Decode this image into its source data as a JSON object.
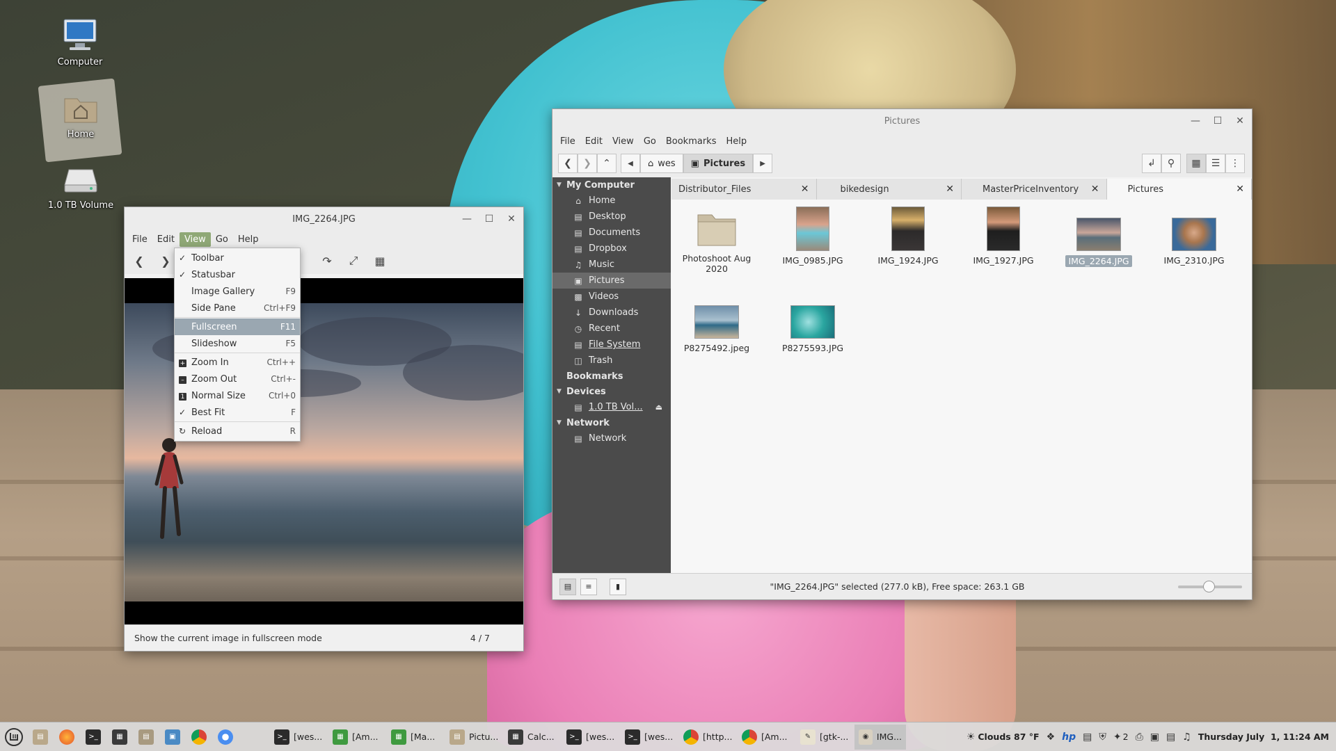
{
  "desktop": {
    "icons": [
      {
        "label": "Computer"
      },
      {
        "label": "Home"
      },
      {
        "label": "1.0 TB Volume"
      }
    ]
  },
  "viewer": {
    "title": "IMG_2264.JPG",
    "menu": [
      "File",
      "Edit",
      "View",
      "Go",
      "Help"
    ],
    "view_menu": [
      {
        "label": "Toolbar",
        "accel": "",
        "mark": "check"
      },
      {
        "label": "Statusbar",
        "accel": "",
        "mark": "check"
      },
      {
        "label": "Image Gallery",
        "accel": "F9",
        "mark": ""
      },
      {
        "label": "Side Pane",
        "accel": "Ctrl+F9",
        "mark": ""
      },
      {
        "label": "Fullscreen",
        "accel": "F11",
        "mark": ""
      },
      {
        "label": "Slideshow",
        "accel": "F5",
        "mark": ""
      },
      {
        "label": "Zoom In",
        "accel": "Ctrl++",
        "mark": "zoom-in-icon"
      },
      {
        "label": "Zoom Out",
        "accel": "Ctrl+-",
        "mark": "zoom-out-icon"
      },
      {
        "label": "Normal Size",
        "accel": "Ctrl+0",
        "mark": "normal-size-icon"
      },
      {
        "label": "Best Fit",
        "accel": "F",
        "mark": "check"
      },
      {
        "label": "Reload",
        "accel": "R",
        "mark": "reload-icon"
      }
    ],
    "status_text": "Show the current image in fullscreen mode",
    "position": "4 / 7"
  },
  "fm": {
    "title": "Pictures",
    "menu": [
      "File",
      "Edit",
      "View",
      "Go",
      "Bookmarks",
      "Help"
    ],
    "breadcrumbs": [
      "wes",
      "Pictures"
    ],
    "sidebar": {
      "my_computer": "My Computer",
      "places": [
        "Home",
        "Desktop",
        "Documents",
        "Dropbox",
        "Music",
        "Pictures",
        "Videos",
        "Downloads",
        "Recent",
        "File System",
        "Trash"
      ],
      "bookmarks": "Bookmarks",
      "devices": "Devices",
      "device_items": [
        "1.0 TB Vol..."
      ],
      "network": "Network",
      "network_items": [
        "Network"
      ]
    },
    "tabs": [
      "Distributor_Files",
      "bikedesign",
      "MasterPriceInventory",
      "Pictures"
    ],
    "files": [
      {
        "name": "Photoshoot Aug 2020",
        "kind": "folder"
      },
      {
        "name": "IMG_0985.JPG",
        "kind": "image"
      },
      {
        "name": "IMG_1924.JPG",
        "kind": "image"
      },
      {
        "name": "IMG_1927.JPG",
        "kind": "image"
      },
      {
        "name": "IMG_2264.JPG",
        "kind": "image",
        "selected": true
      },
      {
        "name": "IMG_2310.JPG",
        "kind": "image"
      },
      {
        "name": "P8275492.jpeg",
        "kind": "image"
      },
      {
        "name": "P8275593.JPG",
        "kind": "image"
      }
    ],
    "status": "\"IMG_2264.JPG\" selected (277.0 kB), Free space: 263.1 GB"
  },
  "taskbar": {
    "tasks": [
      "[wes...",
      "[Am...",
      "[Ma...",
      "Pictu...",
      "Calc...",
      "[wes...",
      "[wes...",
      "[http...",
      "[Am...",
      "[gtk-...",
      "IMG..."
    ],
    "weather": "Clouds 87 °F",
    "workspace": "2",
    "clock": "Thursday July  1, 11:24 AM"
  },
  "colors": {
    "accent": "#8fa876",
    "selection": "#9aa7b1",
    "sidebar_bg": "#4b4b4b"
  }
}
